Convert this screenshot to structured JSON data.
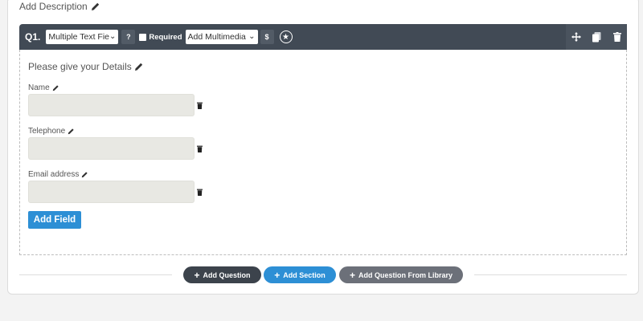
{
  "header": {
    "add_description": "Add Description"
  },
  "question": {
    "number": "Q1.",
    "type_select": "Multiple Text Fie",
    "help_label": "?",
    "required_label": "Required",
    "multimedia_select": "Add Multimedia",
    "dollar_label": "$",
    "title": "Please give your Details",
    "fields": [
      {
        "label": "Name",
        "value": ""
      },
      {
        "label": "Telephone",
        "value": ""
      },
      {
        "label": "Email address",
        "value": ""
      }
    ],
    "add_field_label": "Add Field"
  },
  "actions": {
    "add_question": "Add Question",
    "add_section": "Add Section",
    "add_from_library": "Add Question From Library"
  },
  "colors": {
    "toolbar": "#414a55",
    "primary": "#2d8fd5",
    "dark_pill": "#3c434c",
    "grey_pill": "#6c7079"
  }
}
